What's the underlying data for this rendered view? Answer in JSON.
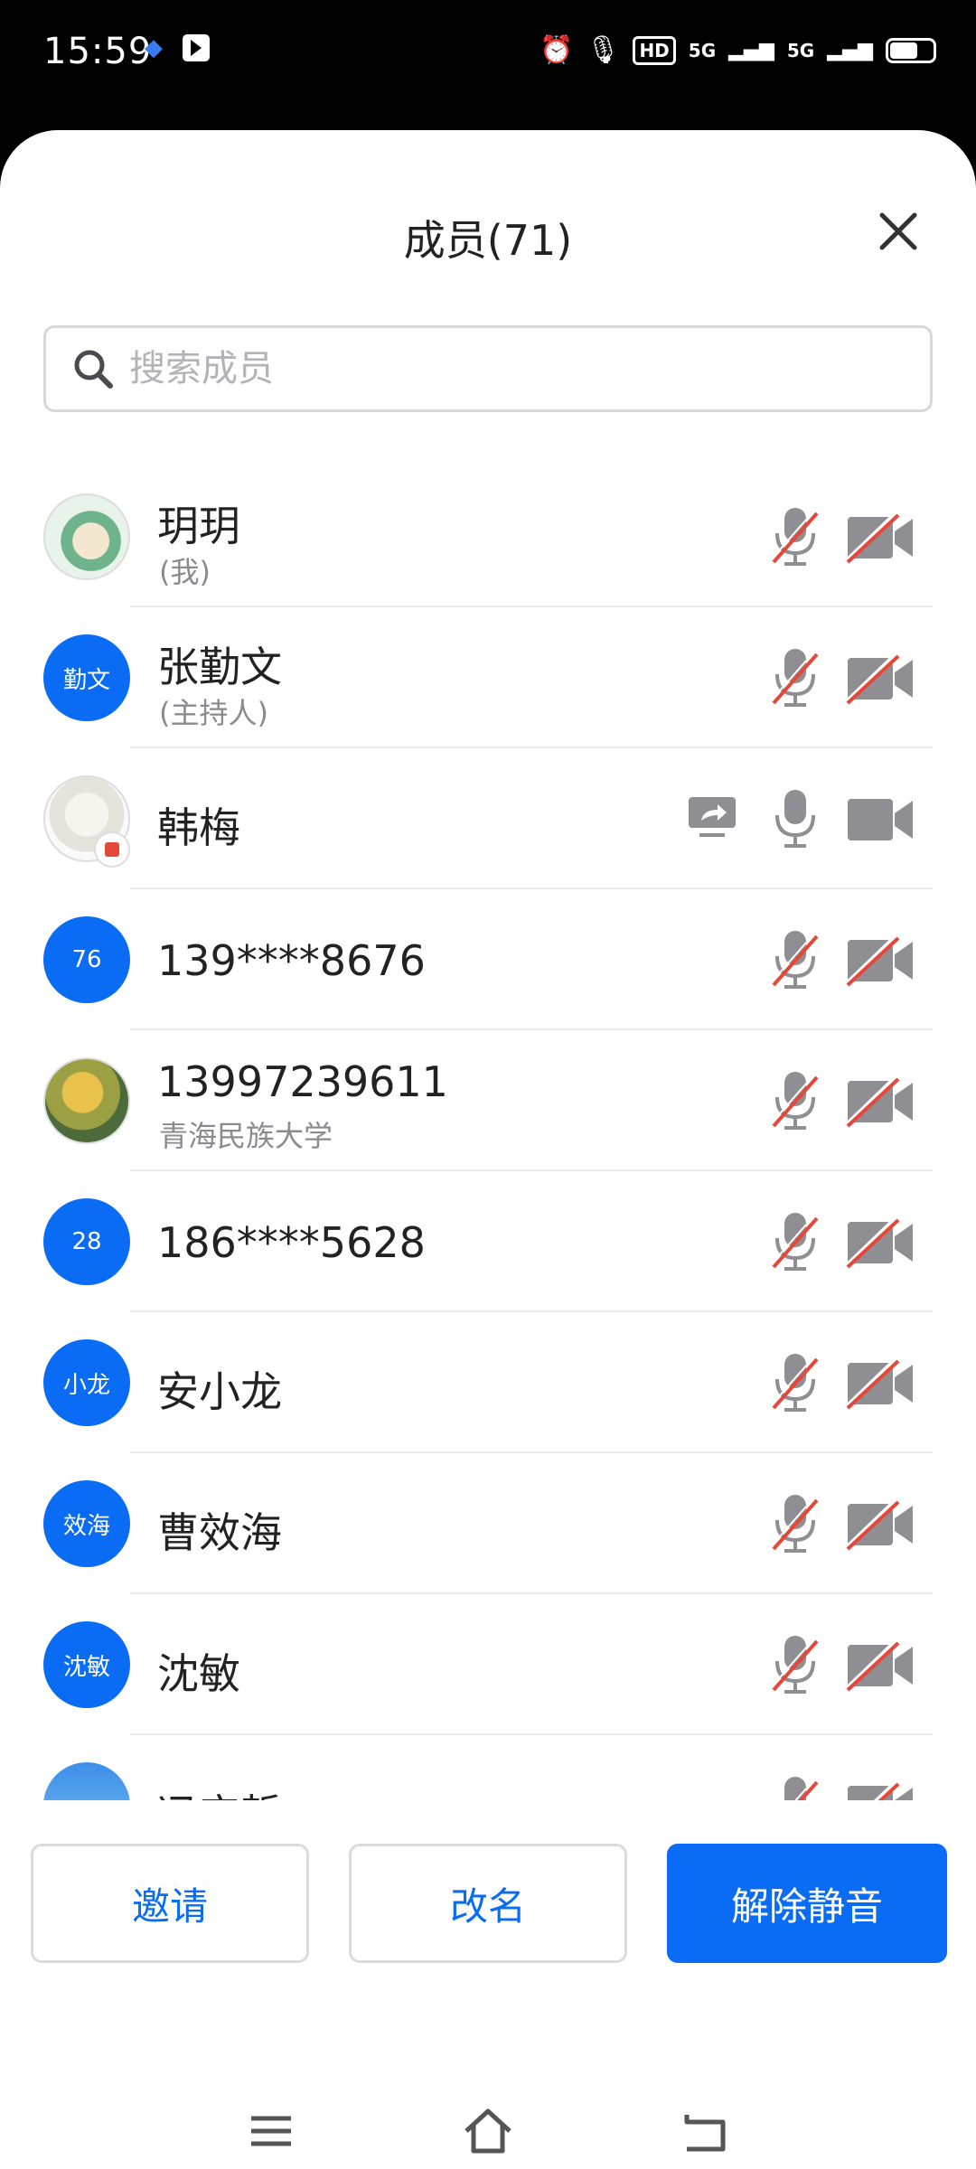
{
  "status": {
    "time": "15:59",
    "network": "5G",
    "hd": "HD"
  },
  "header": {
    "title": "成员(71)"
  },
  "search": {
    "placeholder": "搜索成员",
    "value": ""
  },
  "members": [
    {
      "name": "玥玥",
      "sub": "(我)",
      "avatar_text": "",
      "avatar_style": "pic1",
      "mic": "muted",
      "cam": "off",
      "sharing": false
    },
    {
      "name": "张勤文",
      "sub": "(主持人)",
      "avatar_text": "勤文",
      "avatar_style": "blue",
      "mic": "muted",
      "cam": "off",
      "sharing": false
    },
    {
      "name": "韩梅",
      "sub": "",
      "avatar_text": "",
      "avatar_style": "pic2",
      "mic": "on",
      "cam": "on",
      "sharing": true
    },
    {
      "name": "139****8676",
      "sub": "",
      "avatar_text": "76",
      "avatar_style": "blue",
      "mic": "muted",
      "cam": "off",
      "sharing": false
    },
    {
      "name": "13997239611",
      "sub": "青海民族大学",
      "avatar_text": "",
      "avatar_style": "pic3",
      "mic": "muted",
      "cam": "off",
      "sharing": false
    },
    {
      "name": "186****5628",
      "sub": "",
      "avatar_text": "28",
      "avatar_style": "blue",
      "mic": "muted",
      "cam": "off",
      "sharing": false
    },
    {
      "name": "安小龙",
      "sub": "",
      "avatar_text": "小龙",
      "avatar_style": "blue",
      "mic": "muted",
      "cam": "off",
      "sharing": false
    },
    {
      "name": "曹效海",
      "sub": "",
      "avatar_text": "效海",
      "avatar_style": "blue",
      "mic": "muted",
      "cam": "off",
      "sharing": false
    },
    {
      "name": "沈敏",
      "sub": "",
      "avatar_text": "沈敏",
      "avatar_style": "blue",
      "mic": "muted",
      "cam": "off",
      "sharing": false
    },
    {
      "name": "冯宝哲",
      "sub": "",
      "avatar_text": "",
      "avatar_style": "pic4",
      "mic": "muted",
      "cam": "off",
      "sharing": false
    }
  ],
  "actions": {
    "invite": "邀请",
    "rename": "改名",
    "unmute": "解除静音"
  },
  "colors": {
    "accent": "#0a6cf5",
    "icon_gray": "#8e8e93",
    "muted_slash": "#e5483b"
  },
  "icons": {
    "close": "close-icon",
    "search": "search-icon",
    "mic": "mic-icon",
    "camera": "camera-icon",
    "share": "screen-share-icon"
  }
}
